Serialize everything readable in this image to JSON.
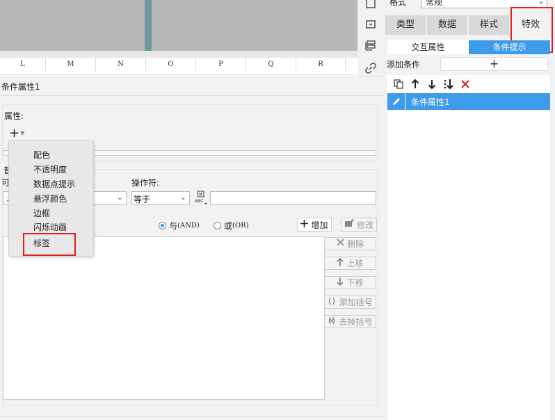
{
  "spreadsheet": {
    "columns": [
      "L",
      "M",
      "N",
      "O",
      "P",
      "Q",
      "R"
    ]
  },
  "right_panel": {
    "format_label": "格式",
    "format_value": "常规",
    "tabs": [
      {
        "label": "类型"
      },
      {
        "label": "数据"
      },
      {
        "label": "样式"
      },
      {
        "label": "特效"
      }
    ],
    "subtabs": [
      {
        "label": "交互属性"
      },
      {
        "label": "条件提示"
      }
    ],
    "add_condition_label": "添加条件",
    "add_condition_button": "+",
    "condition_items": [
      {
        "label": "条件属性1"
      }
    ]
  },
  "dialog": {
    "title": "条件属性1",
    "attribute_label": "属性:",
    "plus_symbol": "+",
    "hidden_label1": "普",
    "hidden_label2": "可",
    "operator_label": "操作符:",
    "left_select_value": "ネ",
    "operator_value": "等于",
    "abc_icon_text": "ABC",
    "radio_and": "与",
    "radio_and_suffix": "(AND)",
    "radio_or": "或",
    "radio_or_suffix": "(OR)",
    "buttons": {
      "add": "增加",
      "modify": "修改",
      "delete": "删除",
      "move_up": "上移",
      "move_down": "下移",
      "add_paren": "添加括号",
      "remove_paren": "去掉括号"
    }
  },
  "popup_menu": {
    "items": [
      {
        "label": "配色"
      },
      {
        "label": "不透明度"
      },
      {
        "label": "数据点提示"
      },
      {
        "label": "悬浮颜色"
      },
      {
        "label": "边框"
      },
      {
        "label": "闪烁动画"
      },
      {
        "label": "标签"
      }
    ]
  },
  "colors": {
    "accent_blue": "#3d9bea",
    "highlight_red": "#e02020",
    "panel_bg": "#f2f2f2"
  }
}
